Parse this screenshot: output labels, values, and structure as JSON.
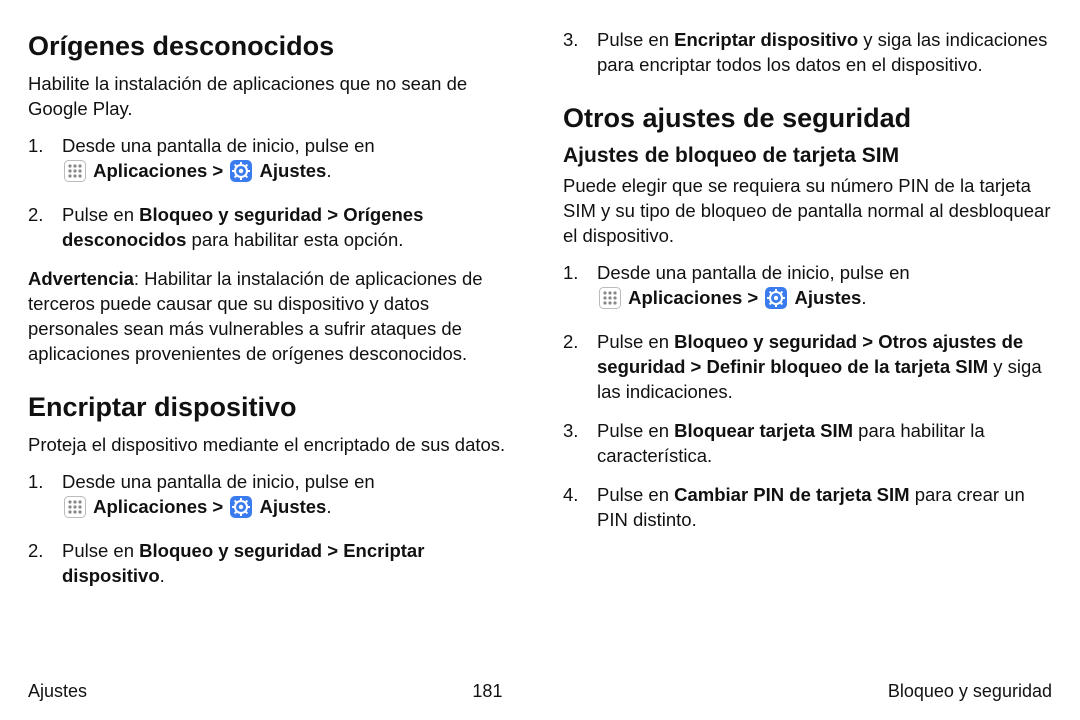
{
  "icons": {
    "apps": "apps-grid-icon",
    "settings": "settings-gear-icon"
  },
  "labels": {
    "aplicaciones": "Aplicaciones",
    "ajustes": "Ajustes",
    "chevron": ">"
  },
  "left": {
    "h1": "Orígenes desconocidos",
    "p1": "Habilite la instalación de aplicaciones que no sean de Google Play.",
    "s1": {
      "num": "1.",
      "a": "Desde una pantalla de inicio, pulse en",
      "period": "."
    },
    "s2": {
      "num": "2.",
      "a": "Pulse en ",
      "b": "Bloqueo y seguridad > Orígenes desconocidos",
      "c": " para habilitar esta opción."
    },
    "warn": {
      "a": "Advertencia",
      "b": ": Habilitar la instalación de aplicaciones de terceros puede causar que su dispositivo y datos personales sean más vulnerables a sufrir ataques de aplicaciones provenientes de orígenes desconocidos."
    },
    "h2": "Encriptar dispositivo",
    "p2": "Proteja el dispositivo mediante el encriptado de sus datos.",
    "e1": {
      "num": "1.",
      "a": "Desde una pantalla de inicio, pulse en",
      "period": "."
    },
    "e2": {
      "num": "2.",
      "a": "Pulse en ",
      "b": "Bloqueo y seguridad > Encriptar dispositivo",
      "c": "."
    }
  },
  "right": {
    "cont3": {
      "num": "3.",
      "a": "Pulse en ",
      "b": "Encriptar dispositivo",
      "c": " y siga las indicaciones para encriptar todos los datos en el dispositivo."
    },
    "h1": "Otros ajustes de seguridad",
    "sub1": "Ajustes de bloqueo de tarjeta SIM",
    "p1": "Puede elegir que se requiera su número PIN de la tarjeta SIM y su tipo de bloqueo de pantalla normal al desbloquear el dispositivo.",
    "s1": {
      "num": "1.",
      "a": "Desde una pantalla de inicio, pulse en",
      "period": "."
    },
    "s2": {
      "num": "2.",
      "a": "Pulse en ",
      "b": "Bloqueo y seguridad > Otros ajustes de seguridad > Definir bloqueo de la tarjeta SIM",
      "c": " y siga las indicaciones."
    },
    "s3": {
      "num": "3.",
      "a": "Pulse en ",
      "b": "Bloquear tarjeta SIM",
      "c": " para habilitar la característica."
    },
    "s4": {
      "num": "4.",
      "a": "Pulse en ",
      "b": "Cambiar PIN de tarjeta SIM",
      "c": " para crear un PIN distinto."
    }
  },
  "footer": {
    "left": "Ajustes",
    "center": "181",
    "right": "Bloqueo y seguridad"
  }
}
